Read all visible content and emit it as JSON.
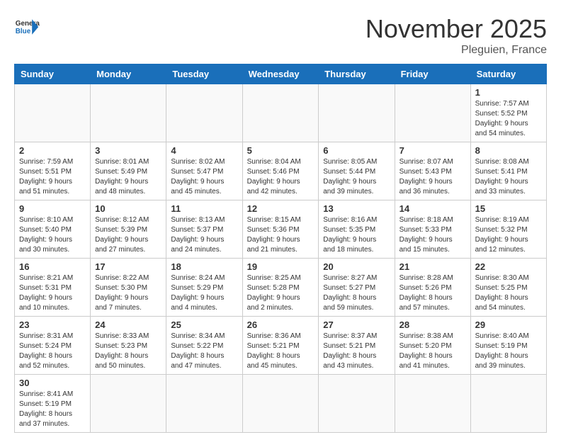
{
  "logo": {
    "text_general": "General",
    "text_blue": "Blue"
  },
  "header": {
    "month_year": "November 2025",
    "location": "Pleguien, France"
  },
  "weekdays": [
    "Sunday",
    "Monday",
    "Tuesday",
    "Wednesday",
    "Thursday",
    "Friday",
    "Saturday"
  ],
  "weeks": [
    [
      {
        "day": "",
        "info": ""
      },
      {
        "day": "",
        "info": ""
      },
      {
        "day": "",
        "info": ""
      },
      {
        "day": "",
        "info": ""
      },
      {
        "day": "",
        "info": ""
      },
      {
        "day": "",
        "info": ""
      },
      {
        "day": "1",
        "info": "Sunrise: 7:57 AM\nSunset: 5:52 PM\nDaylight: 9 hours\nand 54 minutes."
      }
    ],
    [
      {
        "day": "2",
        "info": "Sunrise: 7:59 AM\nSunset: 5:51 PM\nDaylight: 9 hours\nand 51 minutes."
      },
      {
        "day": "3",
        "info": "Sunrise: 8:01 AM\nSunset: 5:49 PM\nDaylight: 9 hours\nand 48 minutes."
      },
      {
        "day": "4",
        "info": "Sunrise: 8:02 AM\nSunset: 5:47 PM\nDaylight: 9 hours\nand 45 minutes."
      },
      {
        "day": "5",
        "info": "Sunrise: 8:04 AM\nSunset: 5:46 PM\nDaylight: 9 hours\nand 42 minutes."
      },
      {
        "day": "6",
        "info": "Sunrise: 8:05 AM\nSunset: 5:44 PM\nDaylight: 9 hours\nand 39 minutes."
      },
      {
        "day": "7",
        "info": "Sunrise: 8:07 AM\nSunset: 5:43 PM\nDaylight: 9 hours\nand 36 minutes."
      },
      {
        "day": "8",
        "info": "Sunrise: 8:08 AM\nSunset: 5:41 PM\nDaylight: 9 hours\nand 33 minutes."
      }
    ],
    [
      {
        "day": "9",
        "info": "Sunrise: 8:10 AM\nSunset: 5:40 PM\nDaylight: 9 hours\nand 30 minutes."
      },
      {
        "day": "10",
        "info": "Sunrise: 8:12 AM\nSunset: 5:39 PM\nDaylight: 9 hours\nand 27 minutes."
      },
      {
        "day": "11",
        "info": "Sunrise: 8:13 AM\nSunset: 5:37 PM\nDaylight: 9 hours\nand 24 minutes."
      },
      {
        "day": "12",
        "info": "Sunrise: 8:15 AM\nSunset: 5:36 PM\nDaylight: 9 hours\nand 21 minutes."
      },
      {
        "day": "13",
        "info": "Sunrise: 8:16 AM\nSunset: 5:35 PM\nDaylight: 9 hours\nand 18 minutes."
      },
      {
        "day": "14",
        "info": "Sunrise: 8:18 AM\nSunset: 5:33 PM\nDaylight: 9 hours\nand 15 minutes."
      },
      {
        "day": "15",
        "info": "Sunrise: 8:19 AM\nSunset: 5:32 PM\nDaylight: 9 hours\nand 12 minutes."
      }
    ],
    [
      {
        "day": "16",
        "info": "Sunrise: 8:21 AM\nSunset: 5:31 PM\nDaylight: 9 hours\nand 10 minutes."
      },
      {
        "day": "17",
        "info": "Sunrise: 8:22 AM\nSunset: 5:30 PM\nDaylight: 9 hours\nand 7 minutes."
      },
      {
        "day": "18",
        "info": "Sunrise: 8:24 AM\nSunset: 5:29 PM\nDaylight: 9 hours\nand 4 minutes."
      },
      {
        "day": "19",
        "info": "Sunrise: 8:25 AM\nSunset: 5:28 PM\nDaylight: 9 hours\nand 2 minutes."
      },
      {
        "day": "20",
        "info": "Sunrise: 8:27 AM\nSunset: 5:27 PM\nDaylight: 8 hours\nand 59 minutes."
      },
      {
        "day": "21",
        "info": "Sunrise: 8:28 AM\nSunset: 5:26 PM\nDaylight: 8 hours\nand 57 minutes."
      },
      {
        "day": "22",
        "info": "Sunrise: 8:30 AM\nSunset: 5:25 PM\nDaylight: 8 hours\nand 54 minutes."
      }
    ],
    [
      {
        "day": "23",
        "info": "Sunrise: 8:31 AM\nSunset: 5:24 PM\nDaylight: 8 hours\nand 52 minutes."
      },
      {
        "day": "24",
        "info": "Sunrise: 8:33 AM\nSunset: 5:23 PM\nDaylight: 8 hours\nand 50 minutes."
      },
      {
        "day": "25",
        "info": "Sunrise: 8:34 AM\nSunset: 5:22 PM\nDaylight: 8 hours\nand 47 minutes."
      },
      {
        "day": "26",
        "info": "Sunrise: 8:36 AM\nSunset: 5:21 PM\nDaylight: 8 hours\nand 45 minutes."
      },
      {
        "day": "27",
        "info": "Sunrise: 8:37 AM\nSunset: 5:21 PM\nDaylight: 8 hours\nand 43 minutes."
      },
      {
        "day": "28",
        "info": "Sunrise: 8:38 AM\nSunset: 5:20 PM\nDaylight: 8 hours\nand 41 minutes."
      },
      {
        "day": "29",
        "info": "Sunrise: 8:40 AM\nSunset: 5:19 PM\nDaylight: 8 hours\nand 39 minutes."
      }
    ],
    [
      {
        "day": "30",
        "info": "Sunrise: 8:41 AM\nSunset: 5:19 PM\nDaylight: 8 hours\nand 37 minutes."
      },
      {
        "day": "",
        "info": ""
      },
      {
        "day": "",
        "info": ""
      },
      {
        "day": "",
        "info": ""
      },
      {
        "day": "",
        "info": ""
      },
      {
        "day": "",
        "info": ""
      },
      {
        "day": "",
        "info": ""
      }
    ]
  ]
}
